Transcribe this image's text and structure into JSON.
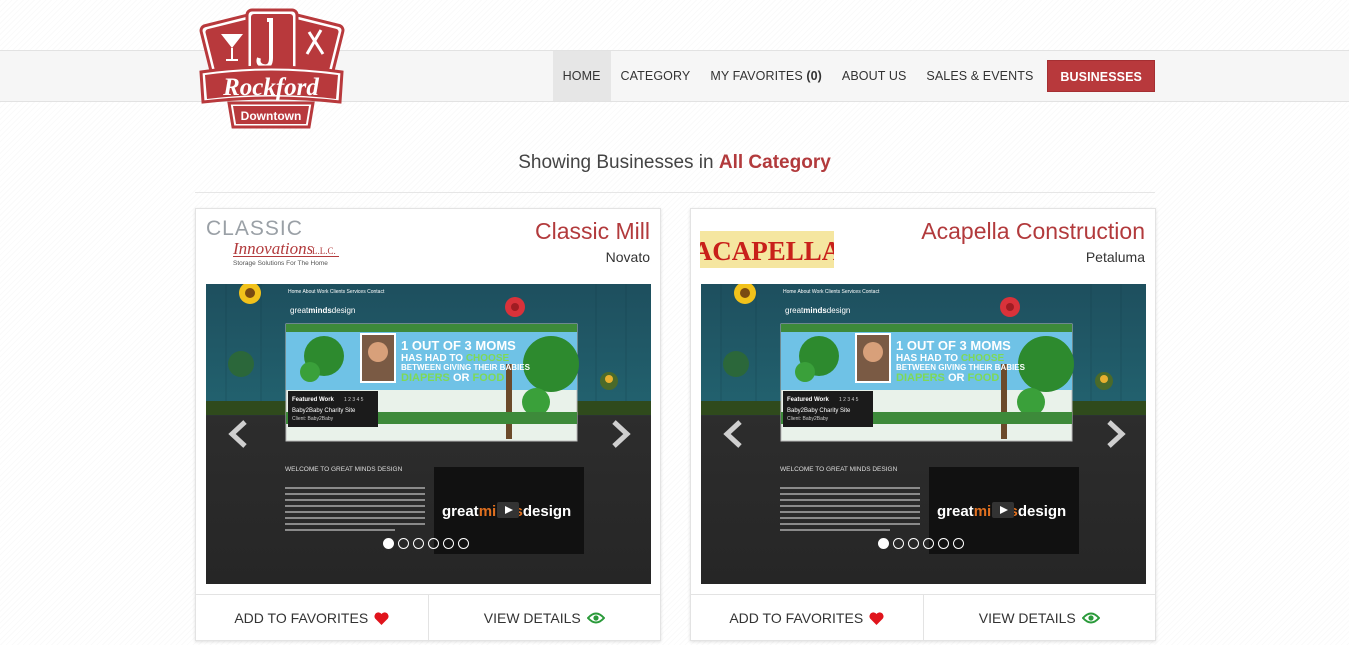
{
  "logo": {
    "line1": "Rockford",
    "line2": "Downtown"
  },
  "nav": {
    "items": [
      {
        "label": "HOME",
        "active": true
      },
      {
        "label": "CATEGORY"
      },
      {
        "label": "MY FAVORITES",
        "count": "(0)"
      },
      {
        "label": "ABOUT US"
      },
      {
        "label": "SALES & EVENTS"
      },
      {
        "label": "BUSINESSES",
        "highlight": true
      }
    ]
  },
  "heading": {
    "prefix": "Showing Businesses in",
    "category": "All Category"
  },
  "businesses": [
    {
      "name": "Classic Mill",
      "city": "Novato",
      "logo": {
        "line1": "CLASSIC",
        "line2": "Innovations",
        "suffix": "L.L.C.",
        "tagline": "Storage Solutions For The Home"
      },
      "add_label": "ADD TO FAVORITES",
      "view_label": "VIEW DETAILS"
    },
    {
      "name": "Acapella Construction",
      "city": "Petaluma",
      "logo": {
        "line1": "ACAPELLA"
      },
      "add_label": "ADD TO FAVORITES",
      "view_label": "VIEW DETAILS"
    }
  ],
  "slide": {
    "site_nav": [
      "Home",
      "About",
      "Work",
      "Clients",
      "Services",
      "Contact"
    ],
    "brand": "greatmindsdesign",
    "brand_plain": "great",
    "brand_bold": "minds",
    "brand_tail": "design",
    "banner_line1": "1 OUT OF 3 MOMS",
    "banner_line2": "HAS HAD TO",
    "banner_line2b": "CHOOSE",
    "banner_line3": "BETWEEN GIVING THEIR BABIES",
    "banner_line4": "DIAPERS",
    "banner_line4b": "OR",
    "banner_line4c": "FOOD",
    "featured_label": "Featured Work",
    "featured_pages": "1 2 3 4 5",
    "featured_title": "Baby2Baby Charity Site",
    "featured_client": "Client: Baby2Baby",
    "welcome": "WELCOME TO GREAT MINDS DESIGN",
    "dot_count": 6,
    "active_dot": 0
  },
  "colors": {
    "accent": "#b23a3c",
    "heart": "#e0141c",
    "eye": "#2a9a3a"
  },
  "icons": {
    "heart": "heart-icon",
    "eye": "eye-icon",
    "prev": "chevron-left-icon",
    "next": "chevron-right-icon"
  }
}
